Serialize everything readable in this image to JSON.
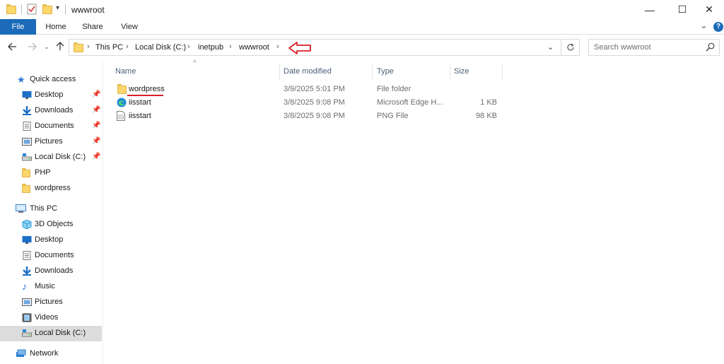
{
  "window": {
    "title": "wwwroot",
    "controls": {
      "minimize": "—",
      "maximize": "☐",
      "close": "✕"
    }
  },
  "ribbon": {
    "tabs": [
      "File",
      "Home",
      "Share",
      "View"
    ],
    "collapse_glyph": "⌄",
    "help_glyph": "?"
  },
  "address": {
    "crumbs": [
      "This PC",
      "Local Disk (C:)",
      "inetpub",
      "wwwroot"
    ],
    "separator": "›",
    "annotation": "red-outline-arrow-pointing-left"
  },
  "search": {
    "placeholder": "Search wwwroot"
  },
  "nav": {
    "quick_access": {
      "label": "Quick access",
      "items": [
        {
          "label": "Desktop",
          "icon": "desktop-icon",
          "pinned": true
        },
        {
          "label": "Downloads",
          "icon": "downloads-icon",
          "pinned": true
        },
        {
          "label": "Documents",
          "icon": "documents-icon",
          "pinned": true
        },
        {
          "label": "Pictures",
          "icon": "pictures-icon",
          "pinned": true
        },
        {
          "label": "Local Disk (C:)",
          "icon": "drive-icon",
          "pinned": true
        },
        {
          "label": "PHP",
          "icon": "folder-icon",
          "pinned": false
        },
        {
          "label": "wordpress",
          "icon": "folder-icon",
          "pinned": false
        }
      ]
    },
    "this_pc": {
      "label": "This PC",
      "items": [
        {
          "label": "3D Objects",
          "icon": "3d-objects-icon"
        },
        {
          "label": "Desktop",
          "icon": "desktop-icon"
        },
        {
          "label": "Documents",
          "icon": "documents-icon"
        },
        {
          "label": "Downloads",
          "icon": "downloads-icon"
        },
        {
          "label": "Music",
          "icon": "music-icon"
        },
        {
          "label": "Pictures",
          "icon": "pictures-icon"
        },
        {
          "label": "Videos",
          "icon": "videos-icon"
        },
        {
          "label": "Local Disk (C:)",
          "icon": "drive-icon",
          "selected": true
        }
      ]
    },
    "network": {
      "label": "Network"
    }
  },
  "files": {
    "columns": {
      "name": "Name",
      "date": "Date modified",
      "type": "Type",
      "size": "Size"
    },
    "sort_glyph": "^",
    "rows": [
      {
        "name": "wordpress",
        "date": "3/9/2025 5:01 PM",
        "type": "File folder",
        "size": "",
        "icon": "folder-icon",
        "underlined": true
      },
      {
        "name": "iisstart",
        "date": "3/8/2025 9:08 PM",
        "type": "Microsoft Edge H...",
        "size": "1 KB",
        "icon": "edge-html-icon"
      },
      {
        "name": "iisstart",
        "date": "3/8/2025 9:08 PM",
        "type": "PNG File",
        "size": "98 KB",
        "icon": "png-file-icon"
      }
    ]
  },
  "colors": {
    "file_tab": "#1c6bb8",
    "annotation_red": "#d6202a",
    "folder": "#fcd76b",
    "selected_nav": "#dcdcdc"
  }
}
